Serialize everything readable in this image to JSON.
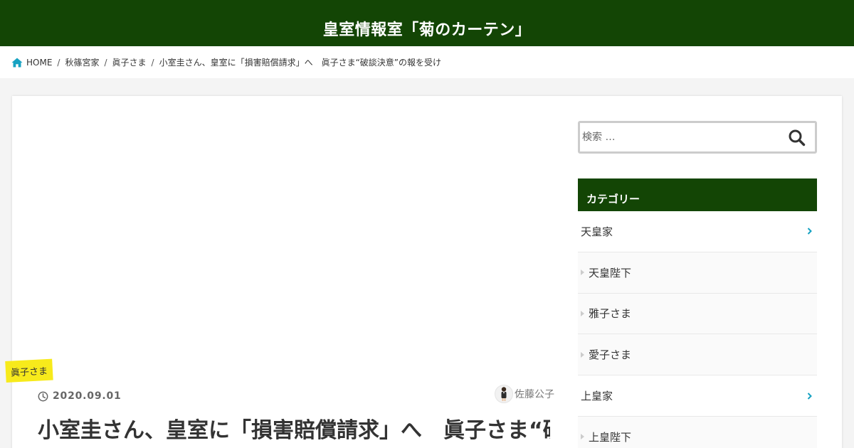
{
  "site": {
    "title": "皇室情報室「菊のカーテン」"
  },
  "breadcrumb": {
    "home_icon": "home-icon",
    "items": [
      "HOME",
      "秋篠宮家",
      "眞子さま",
      "小室圭さん、皇室に「損害賠償請求」へ　眞子さま“破談決意”の報を受け"
    ]
  },
  "post": {
    "category": "眞子さま",
    "date": "2020.09.01",
    "author": "佐藤公子",
    "title": "小室圭さん、皇室に「損害賠償請求」へ　眞子さま“破談決意”の報を受け"
  },
  "sidebar": {
    "search": {
      "placeholder": "検索 …",
      "icon": "search-icon"
    },
    "categories_title": "カテゴリー",
    "categories": [
      {
        "label": "天皇家",
        "type": "parent"
      },
      {
        "label": "天皇陛下",
        "type": "child"
      },
      {
        "label": "雅子さま",
        "type": "child"
      },
      {
        "label": "愛子さま",
        "type": "child"
      },
      {
        "label": "上皇家",
        "type": "parent"
      },
      {
        "label": "上皇陛下",
        "type": "child"
      }
    ]
  },
  "colors": {
    "header": "#134505",
    "accent_chevron": "#17a2c2",
    "label_bg": "#f7ea1b"
  }
}
